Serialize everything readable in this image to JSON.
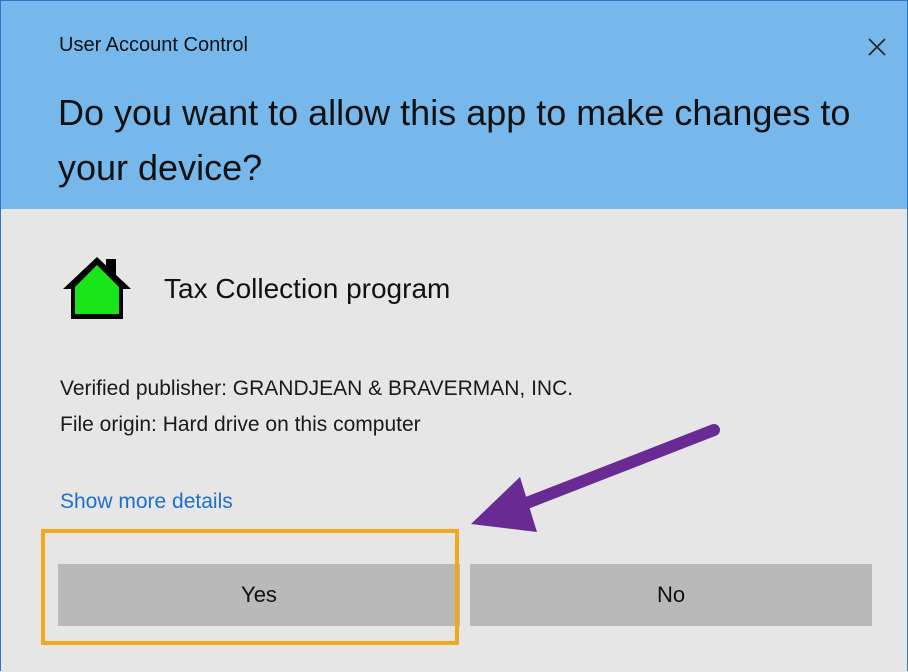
{
  "window": {
    "title": "User Account Control",
    "close_icon": "close-icon"
  },
  "prompt": {
    "question": "Do you want to allow this app to make changes to your device?"
  },
  "app": {
    "icon": "green-house-icon",
    "name": "Tax Collection program",
    "publisher_line": "Verified publisher: GRANDJEAN & BRAVERMAN, INC.",
    "origin_line": "File origin: Hard drive on this computer"
  },
  "details_link": "Show more details",
  "buttons": {
    "yes_label": "Yes",
    "no_label": "No"
  },
  "annotation": {
    "highlight_color": "#f0a81c",
    "arrow_color": "#6a2a93"
  },
  "colors": {
    "header_bg": "#76b8ec",
    "body_bg": "#e6e6e6",
    "link": "#1f6fc4",
    "button_bg": "#b9b9b9"
  }
}
